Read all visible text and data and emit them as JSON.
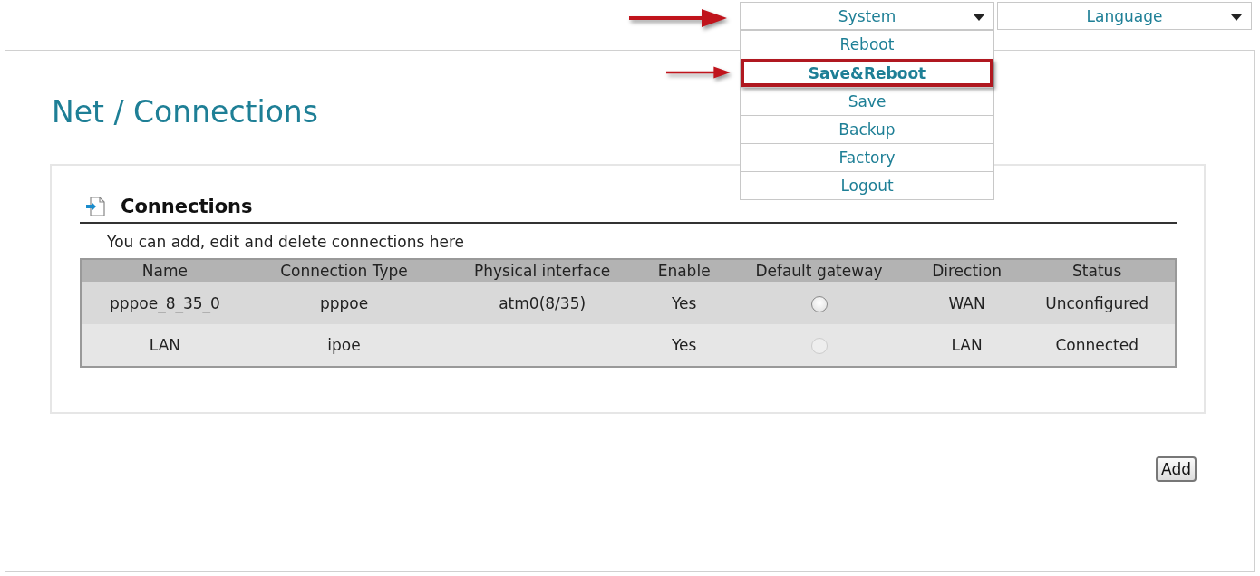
{
  "header": {
    "dropdowns": [
      {
        "label": "System",
        "expanded": true,
        "pointed": true
      },
      {
        "label": "Language",
        "expanded": false,
        "pointed": false
      }
    ],
    "system_menu": [
      {
        "label": "Reboot",
        "marked": false
      },
      {
        "label": "Save&Reboot",
        "marked": true
      },
      {
        "label": "Save",
        "marked": false
      },
      {
        "label": "Backup",
        "marked": false
      },
      {
        "label": "Factory",
        "marked": false
      },
      {
        "label": "Logout",
        "marked": false
      }
    ]
  },
  "page_title": "Net / Connections",
  "section": {
    "title": "Connections",
    "description": "You can add, edit and delete connections here"
  },
  "table": {
    "columns": [
      "Name",
      "Connection Type",
      "Physical interface",
      "Enable",
      "Default gateway",
      "Direction",
      "Status"
    ],
    "rows": [
      {
        "name": "pppoe_8_35_0",
        "type": "pppoe",
        "interface": "atm0(8/35)",
        "enable": "Yes",
        "default_gateway": {
          "selected": false,
          "disabled": false
        },
        "direction": "WAN",
        "status": "Unconfigured"
      },
      {
        "name": "LAN",
        "type": "ipoe",
        "interface": "",
        "enable": "Yes",
        "default_gateway": {
          "selected": false,
          "disabled": true
        },
        "direction": "LAN",
        "status": "Connected"
      }
    ]
  },
  "buttons": [
    "Add"
  ]
}
